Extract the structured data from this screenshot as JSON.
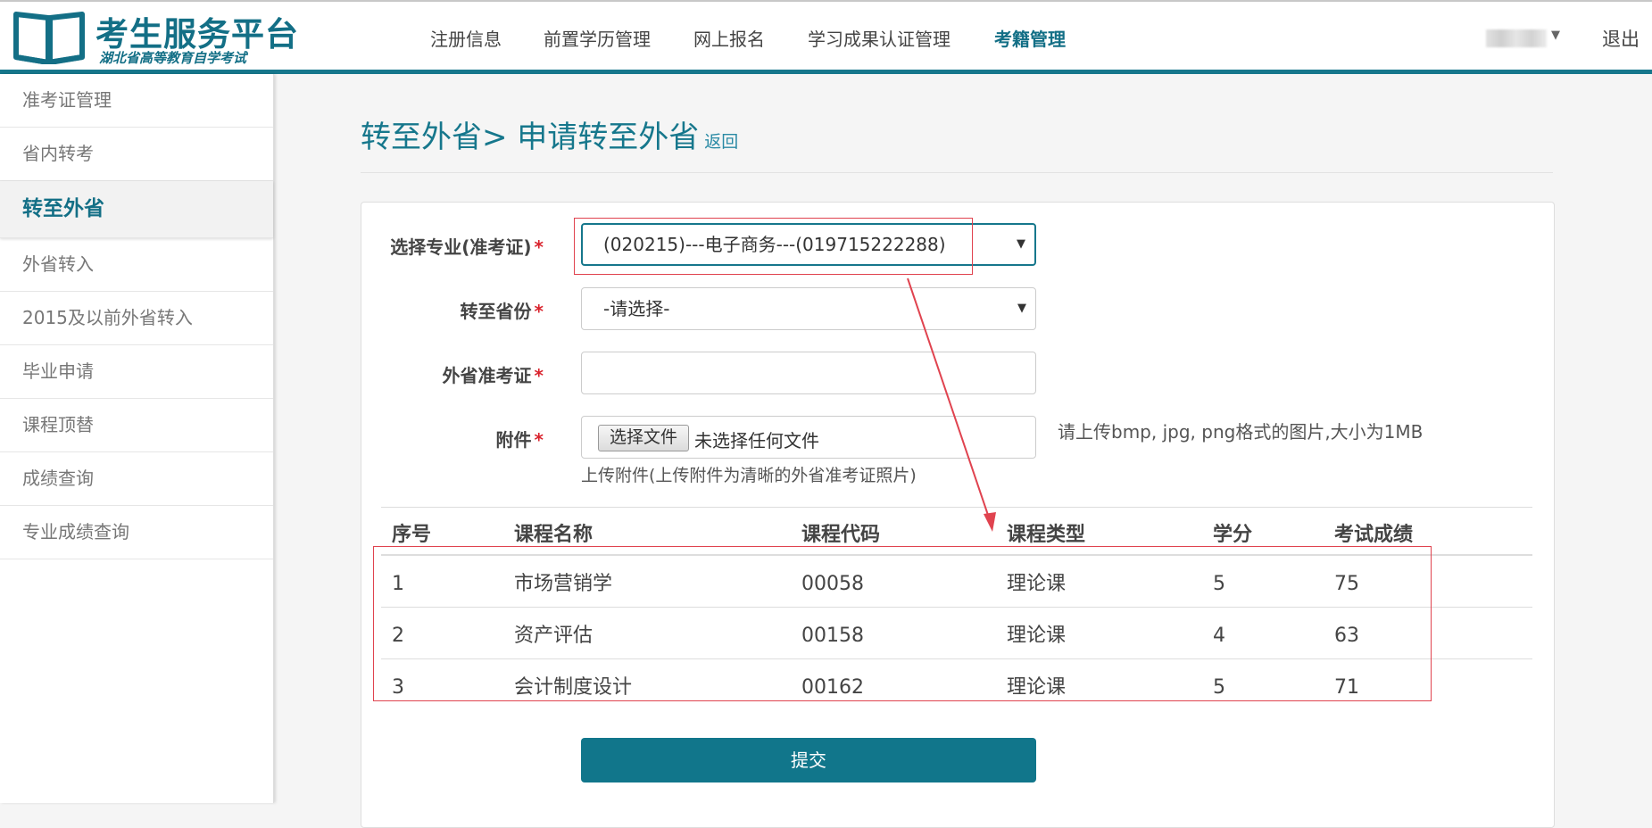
{
  "header": {
    "logo_title": "考生服务平台",
    "logo_subtitle": "湖北省高等教育自学考试",
    "nav": [
      "注册信息",
      "前置学历管理",
      "网上报名",
      "学习成果认证管理",
      "考籍管理"
    ],
    "active_nav": "考籍管理",
    "logout": "退出"
  },
  "sidebar": {
    "items": [
      "准考证管理",
      "省内转考",
      "转至外省",
      "外省转入",
      "2015及以前外省转入",
      "毕业申请",
      "课程顶替",
      "成绩查询",
      "专业成绩查询"
    ],
    "active": "转至外省"
  },
  "page": {
    "title": "转至外省> 申请转至外省",
    "back": "返回"
  },
  "form": {
    "major_label": "选择专业(准考证)",
    "major_value": "(020215)---电子商务---(019715222288)",
    "province_label": "转至省份",
    "province_value": "-请选择-",
    "ticket_label": "外省准考证",
    "ticket_value": "",
    "attach_label": "附件",
    "file_button": "选择文件",
    "file_status": "未选择任何文件",
    "attach_hint": "请上传bmp, jpg, png格式的图片,大小为1MB",
    "attach_subhint": "上传附件(上传附件为清晰的外省准考证照片)",
    "required_mark": "*"
  },
  "table": {
    "headers": [
      "序号",
      "课程名称",
      "课程代码",
      "课程类型",
      "学分",
      "考试成绩"
    ],
    "rows": [
      [
        "1",
        "市场营销学",
        "00058",
        "理论课",
        "5",
        "75"
      ],
      [
        "2",
        "资产评估",
        "00158",
        "理论课",
        "4",
        "63"
      ],
      [
        "3",
        "会计制度设计",
        "00162",
        "理论课",
        "5",
        "71"
      ]
    ]
  },
  "submit_label": "提交",
  "colors": {
    "brand": "#136f86",
    "button": "#11768b",
    "required": "#d9232d",
    "annotation": "#e0434f"
  }
}
